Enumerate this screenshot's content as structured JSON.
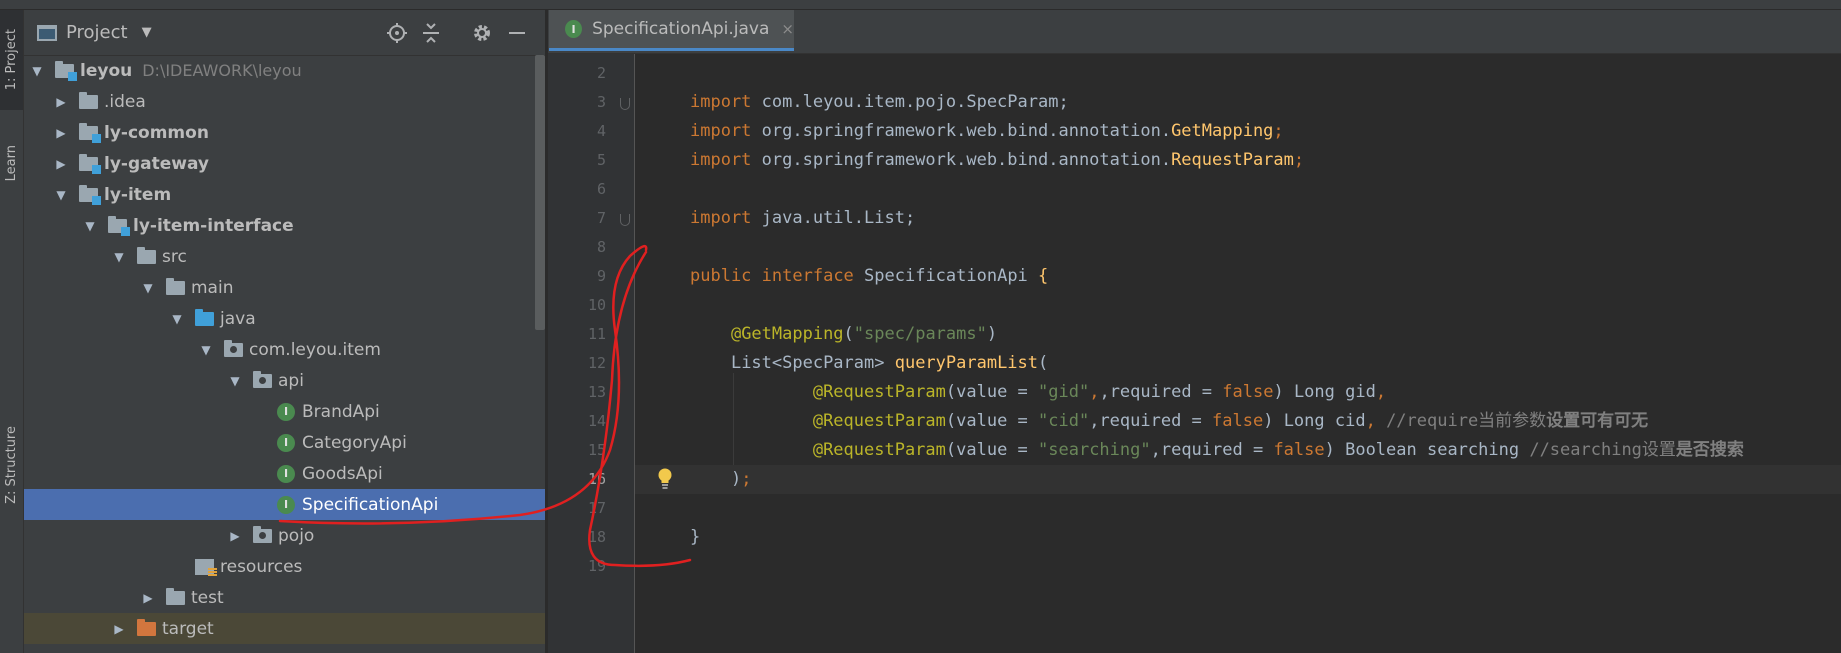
{
  "left_stripe": {
    "tabs": [
      {
        "label": "1: Project"
      },
      {
        "label": "Learn"
      },
      {
        "label": "Z: Structure"
      }
    ]
  },
  "project_panel": {
    "title": "Project",
    "tree": [
      {
        "label": "leyou",
        "path": "D:\\IDEAWORK\\leyou",
        "icon": "module-folder-icon",
        "expanded": true
      },
      {
        "label": ".idea",
        "icon": "folder-icon",
        "expanded": false
      },
      {
        "label": "ly-common",
        "icon": "module-folder-icon",
        "expanded": false
      },
      {
        "label": "ly-gateway",
        "icon": "module-folder-icon",
        "expanded": false
      },
      {
        "label": "ly-item",
        "icon": "module-folder-icon",
        "expanded": true
      },
      {
        "label": "ly-item-interface",
        "icon": "module-folder-icon",
        "expanded": true
      },
      {
        "label": "src",
        "icon": "folder-icon",
        "expanded": true
      },
      {
        "label": "main",
        "icon": "folder-icon",
        "expanded": true
      },
      {
        "label": "java",
        "icon": "source-folder-icon",
        "expanded": true
      },
      {
        "label": "com.leyou.item",
        "icon": "package-icon",
        "expanded": true
      },
      {
        "label": "api",
        "icon": "package-icon",
        "expanded": true
      },
      {
        "label": "BrandApi",
        "icon": "interface-icon"
      },
      {
        "label": "CategoryApi",
        "icon": "interface-icon"
      },
      {
        "label": "GoodsApi",
        "icon": "interface-icon"
      },
      {
        "label": "SpecificationApi",
        "icon": "interface-icon",
        "selected": true
      },
      {
        "label": "pojo",
        "icon": "package-icon",
        "expanded": false
      },
      {
        "label": "resources",
        "icon": "resources-folder-icon"
      },
      {
        "label": "test",
        "icon": "folder-icon",
        "expanded": false
      },
      {
        "label": "target",
        "icon": "excluded-folder-icon",
        "expanded": false
      }
    ]
  },
  "editor": {
    "tab": {
      "label": "SpecificationApi.java",
      "close": "×",
      "icon_letter": "I"
    },
    "current_line": 16,
    "line_numbers": [
      "2",
      "3",
      "4",
      "5",
      "6",
      "7",
      "8",
      "9",
      "10",
      "11",
      "12",
      "13",
      "14",
      "15",
      "16",
      "17",
      "18",
      "19"
    ],
    "lines": {
      "l3": {
        "kw": "import",
        "rest": " com.leyou.item.pojo.SpecParam;"
      },
      "l4": {
        "kw": "import",
        "rest": " org.springframework.web.bind.annotation.",
        "cls": "GetMapping",
        "tail": ";"
      },
      "l5": {
        "kw": "import",
        "rest": " org.springframework.web.bind.annotation.",
        "cls": "RequestParam",
        "tail": ";"
      },
      "l7": {
        "kw": "import",
        "rest": " java.util.List;"
      },
      "l9": {
        "kw1": "public",
        "kw2": "interface",
        "name": " SpecificationApi ",
        "brace": "{"
      },
      "l11": {
        "ann": "@GetMapping",
        "p1": "(",
        "str": "\"spec/params\"",
        "p2": ")"
      },
      "l12": {
        "text": "List<SpecParam> ",
        "method": "queryParamList",
        "p": "("
      },
      "l13": {
        "ann": "@RequestParam",
        "a": "(value = ",
        "str": "\"gid\"",
        "b": ",required = ",
        "kw": "false",
        "c": ") Long gid",
        "comma": ","
      },
      "l14": {
        "ann": "@RequestParam",
        "a": "(value = ",
        "str": "\"cid\"",
        "b": ",required = ",
        "kw": "false",
        "c": ") Long cid",
        "comma": ", ",
        "cmt": "//require当前参数",
        "cmt_bold": "设置可有可无"
      },
      "l15": {
        "ann": "@RequestParam",
        "a": "(value = ",
        "str": "\"searching\"",
        "b": ",required = ",
        "kw": "false",
        "c": ") Boolean searching ",
        "cmt": "//searching设置",
        "cmt_bold": "是否搜索"
      },
      "l16": {
        "text": ")",
        "semi": ";"
      },
      "l18": {
        "text": "}"
      }
    }
  },
  "colors": {
    "keyword": "#cc7832",
    "annotation": "#bbb529",
    "string": "#6a8759",
    "comment": "#808080",
    "method": "#ffc66d",
    "selection": "#4b6eaf",
    "red_ink": "#e02020"
  }
}
